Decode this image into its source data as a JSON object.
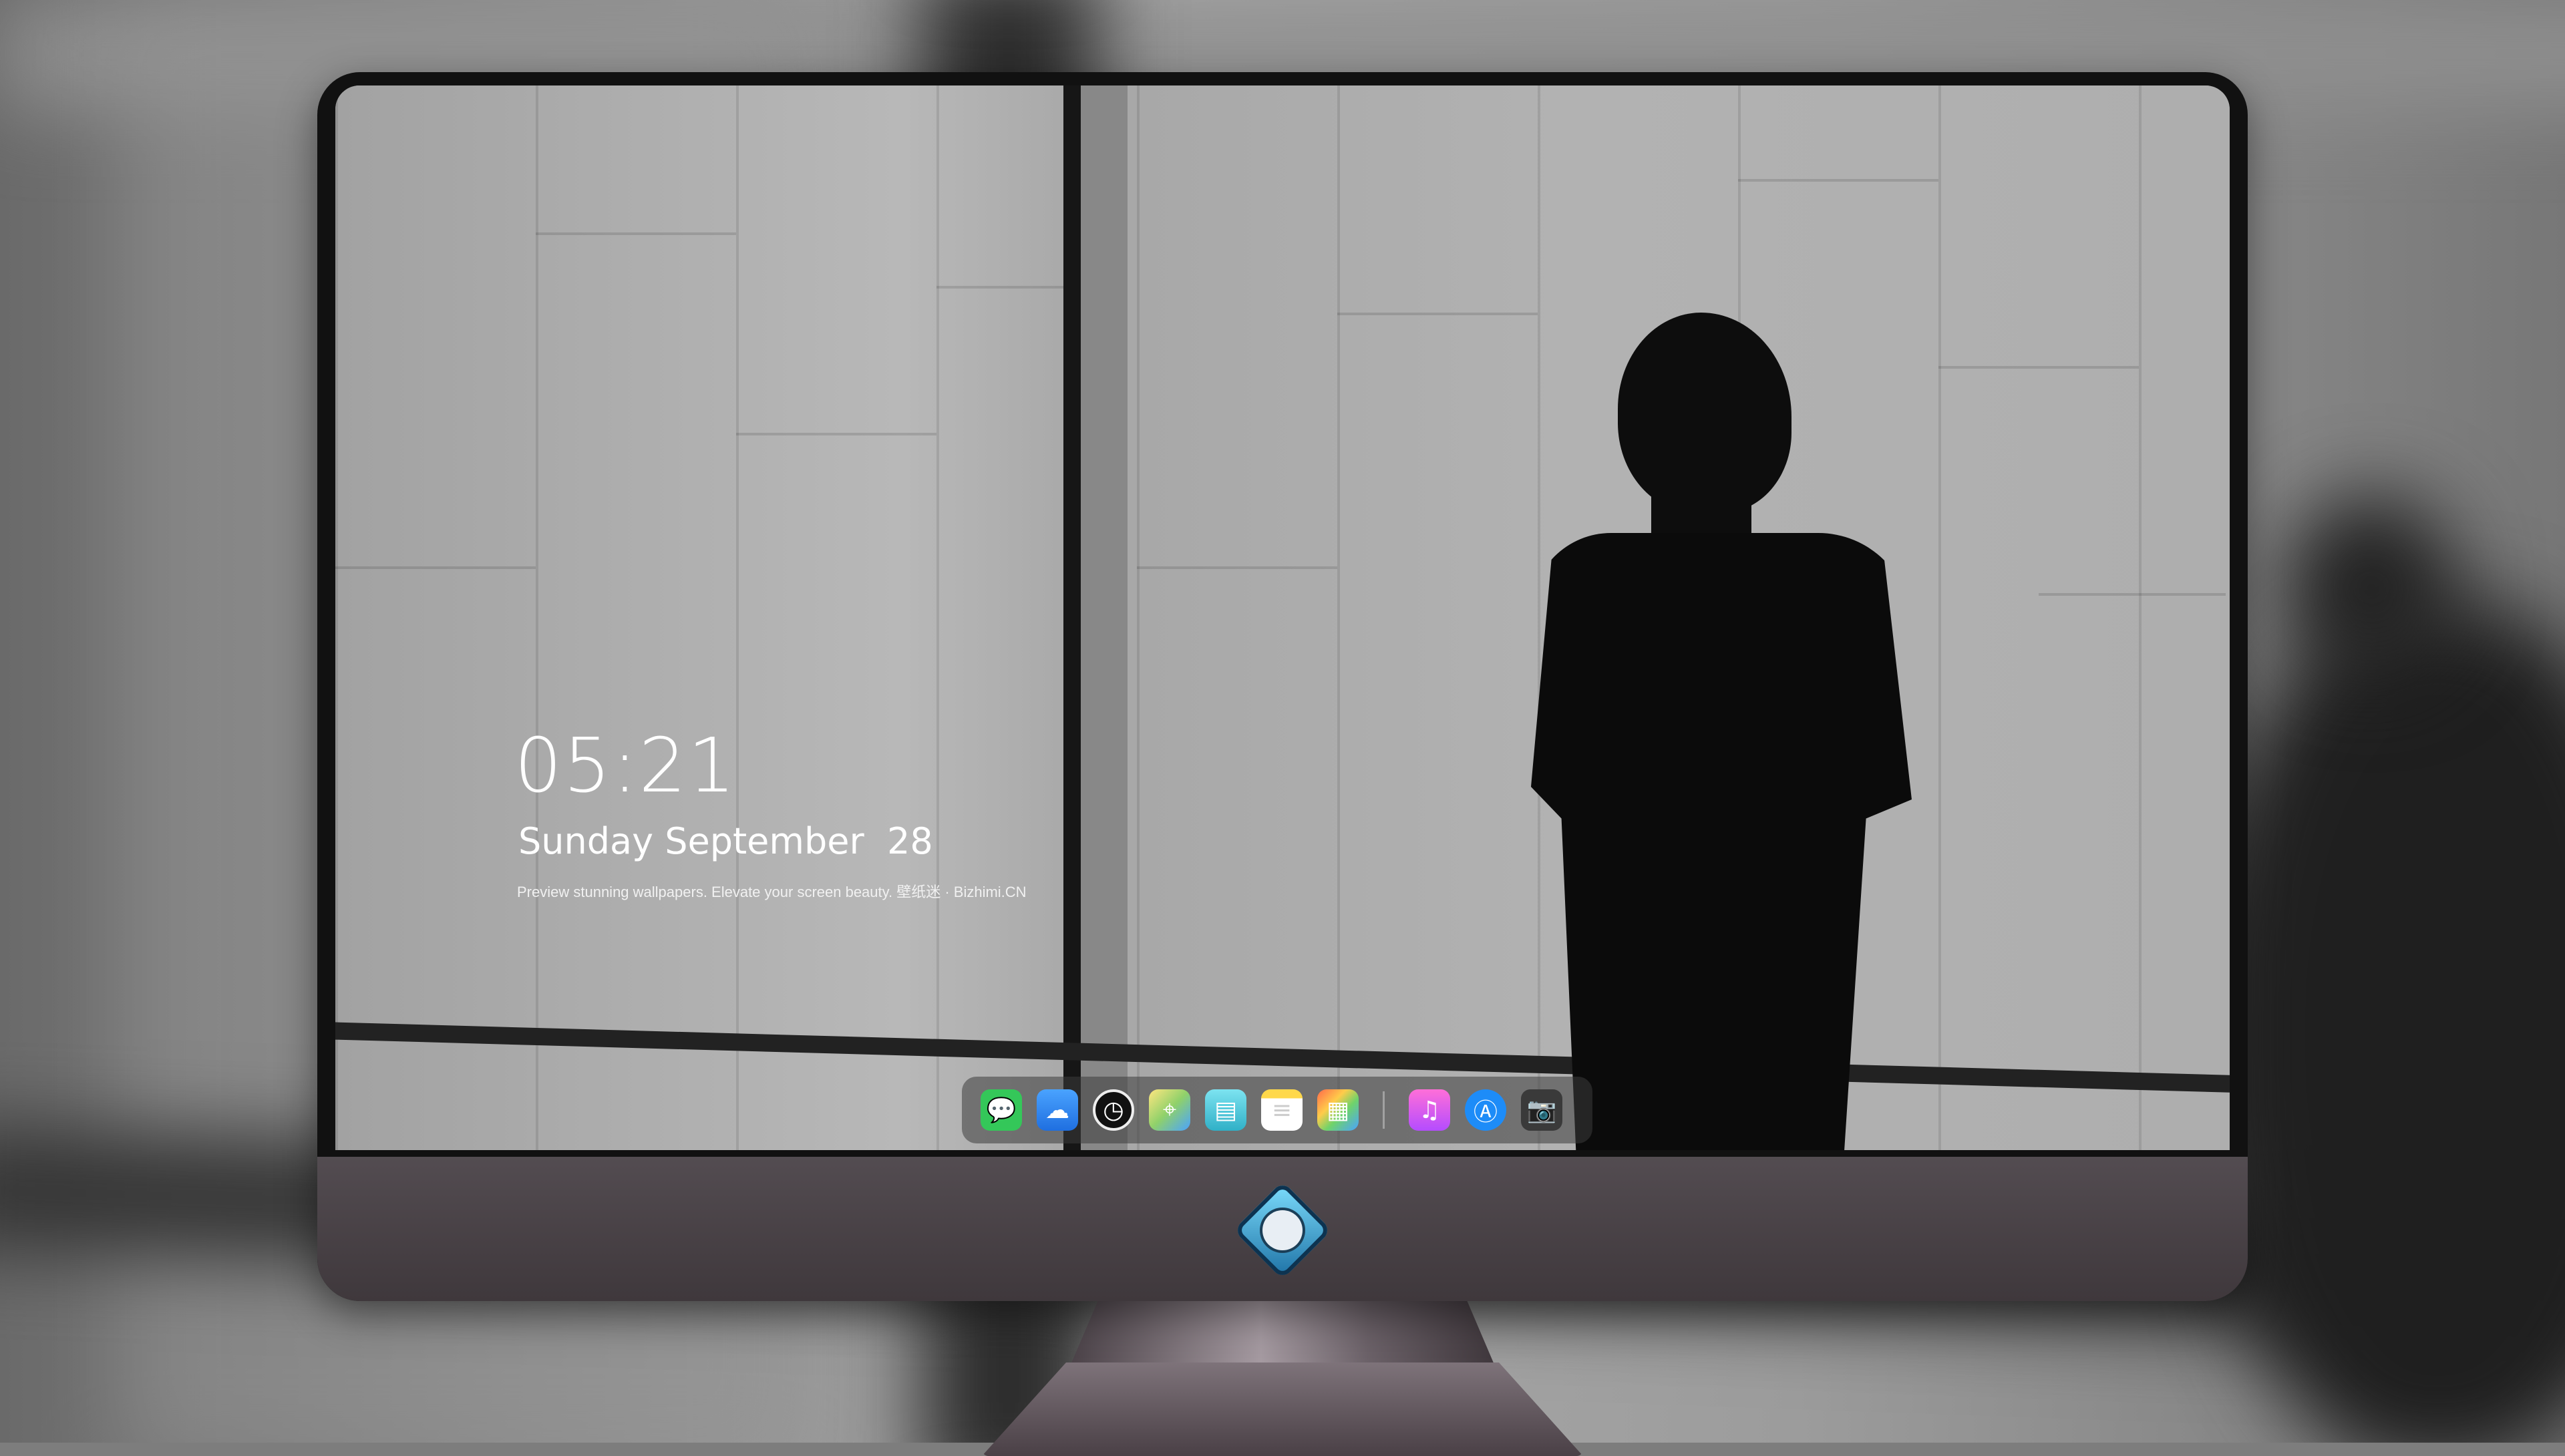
{
  "lock_screen": {
    "time": "05:21",
    "date": "Sunday September  28",
    "tagline": "Preview stunning wallpapers. Elevate your screen beauty. 壁纸迷 · Bizhimi.CN"
  },
  "dock": {
    "apps": [
      {
        "name": "Messages",
        "icon": "messages-icon",
        "glyph": "💬"
      },
      {
        "name": "Weather",
        "icon": "weather-icon",
        "glyph": "☁"
      },
      {
        "name": "Clock",
        "icon": "clock-icon",
        "glyph": "◷"
      },
      {
        "name": "Maps",
        "icon": "maps-icon",
        "glyph": "⌖"
      },
      {
        "name": "Clips",
        "icon": "clapperboard-icon",
        "glyph": "▤"
      },
      {
        "name": "Notes",
        "icon": "notes-icon",
        "glyph": "≡"
      },
      {
        "name": "Photos",
        "icon": "photos-icon",
        "glyph": "▦"
      },
      {
        "name": "Music",
        "icon": "music-icon",
        "glyph": "♫"
      },
      {
        "name": "App Store",
        "icon": "app-store-icon",
        "glyph": "Ⓐ"
      },
      {
        "name": "Camera",
        "icon": "camera-icon",
        "glyph": "📷"
      }
    ]
  },
  "colors": {
    "bezel": "#111111",
    "chin": "#4a4246",
    "dock_bg": "rgba(60,60,60,0.55)"
  }
}
